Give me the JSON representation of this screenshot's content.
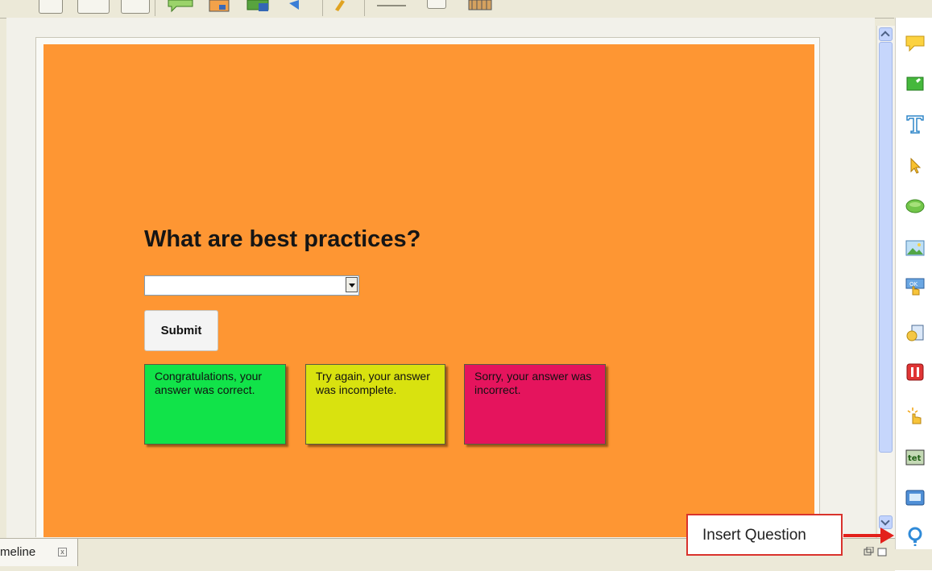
{
  "slide": {
    "background_color": "#fe9633",
    "question": "What are best practices?",
    "dropdown_value": "",
    "submit_label": "Submit",
    "captions": {
      "correct": {
        "text": "Congratulations, your answer was correct.",
        "color": "#11e349"
      },
      "incomplete": {
        "text": "Try again, your answer was incomplete.",
        "color": "#d9e20f"
      },
      "incorrect": {
        "text": "Sorry, your answer was incorrect.",
        "color": "#e5145d"
      }
    }
  },
  "bottom_panel": {
    "tab_label": "meline",
    "tab_close": "x"
  },
  "object_toolbar": {
    "items": [
      "text-caption-icon",
      "highlight-box-icon",
      "text-animation-icon",
      "mouse-icon",
      "rollover-caption-icon",
      "image-icon",
      "button-icon",
      "rollover-image-icon",
      "stop-icon",
      "click-box-icon",
      "text-entry-box-icon",
      "zoom-area-icon",
      "question-icon"
    ]
  },
  "callout": {
    "label": "Insert Question",
    "color": "#e3201b"
  }
}
